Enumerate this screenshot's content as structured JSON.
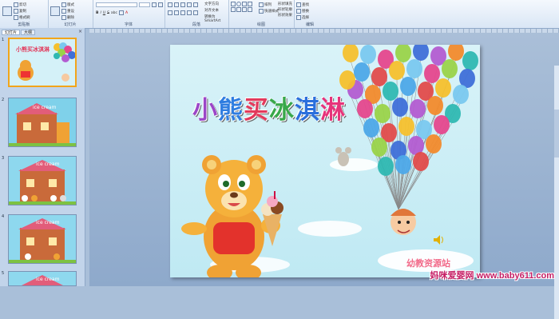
{
  "ribbon": {
    "groups": [
      {
        "label": "剪贴板",
        "items": [
          "粘贴",
          "剪切",
          "复制",
          "格式刷"
        ]
      },
      {
        "label": "幻灯片",
        "items": [
          "新建幻灯片",
          "版式",
          "重设",
          "删除"
        ]
      },
      {
        "label": "字体",
        "items": [
          "B",
          "I",
          "U",
          "S",
          "abc",
          "A"
        ]
      },
      {
        "label": "段落",
        "items": [
          "文字方向",
          "对齐文本",
          "转换为 SmartArt"
        ]
      },
      {
        "label": "绘图",
        "items": [
          "排列",
          "快速样式",
          "形状填充",
          "形状轮廓",
          "形状效果"
        ]
      },
      {
        "label": "编辑",
        "items": [
          "查找",
          "替换",
          "选择"
        ]
      }
    ]
  },
  "pane": {
    "tabs": [
      "幻灯片",
      "大纲"
    ],
    "close": "×",
    "slides": [
      {
        "num": "1",
        "label": "小熊买冰淇淋"
      },
      {
        "num": "2",
        "label": "ice cream"
      },
      {
        "num": "3",
        "label": "ice cream"
      },
      {
        "num": "4",
        "label": "ice cream"
      },
      {
        "num": "5",
        "label": "ice cream"
      }
    ]
  },
  "slide": {
    "title_chars": [
      "小",
      "熊",
      "买",
      "冰",
      "淇",
      "淋"
    ],
    "title_colors": [
      "#9b46c8",
      "#2f7de0",
      "#e23a5c",
      "#38a84a",
      "#2b6fdc",
      "#e6337a"
    ],
    "brand": "幼教资源站",
    "balloon_colors": [
      "#f5c02d",
      "#7ac8ef",
      "#e5478d",
      "#9ad34a",
      "#3f6fd8",
      "#b35cd1",
      "#f28a2c",
      "#2fb8b2",
      "#4da8e8",
      "#e24b4b"
    ]
  },
  "watermark": "妈咪爱婴网 www.baby611.com"
}
